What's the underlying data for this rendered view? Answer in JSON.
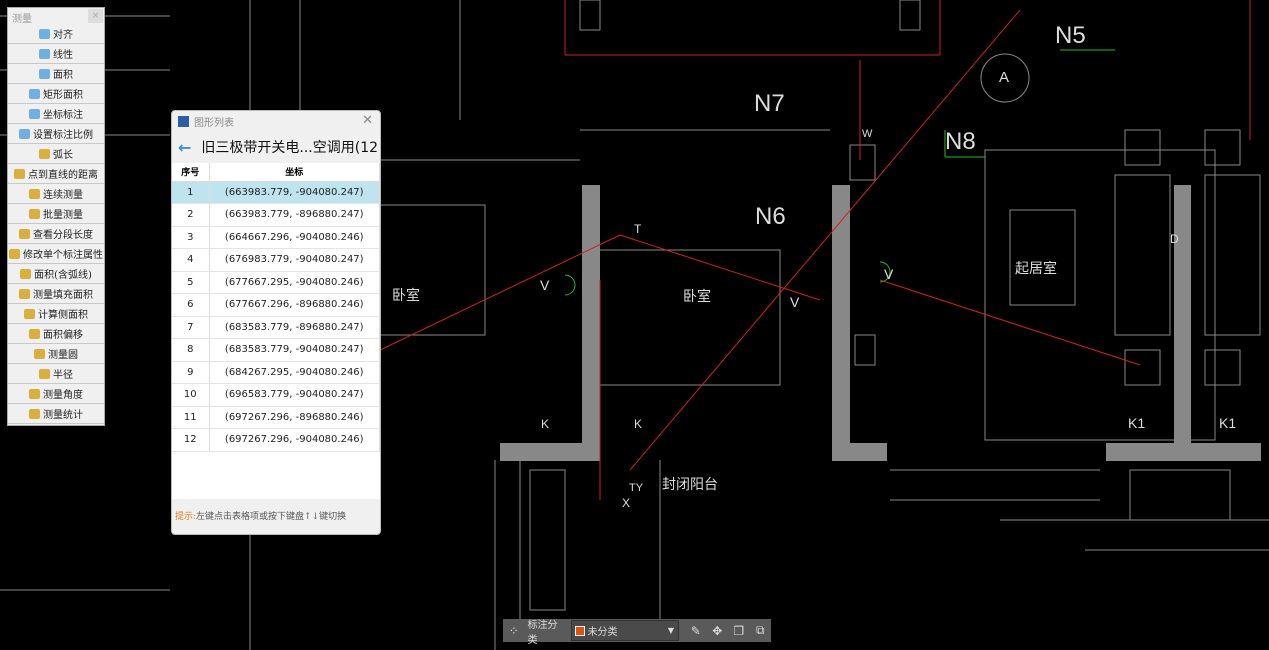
{
  "cad_labels": {
    "n5": "N5",
    "n7": "N7",
    "n8": "N8",
    "n6": "N6",
    "a": "A",
    "w": "W",
    "bedroom1": "卧室",
    "bedroom2": "卧室",
    "living": "起居室",
    "balcony": "封闭阳台",
    "v1": "V",
    "v2": "V",
    "v3": "V",
    "t": "T",
    "k1": "K",
    "k2": "K",
    "ty": "TY",
    "x": "X",
    "k1a": "K1",
    "k1b": "K1",
    "d": "D"
  },
  "measure_panel": {
    "title": "测量",
    "close": "×",
    "items": [
      {
        "label": "对齐",
        "icon": "align-icon"
      },
      {
        "label": "线性",
        "icon": "linear-icon"
      },
      {
        "label": "面积",
        "icon": "area-icon"
      },
      {
        "label": "矩形面积",
        "icon": "rect-area-icon"
      },
      {
        "label": "坐标标注",
        "icon": "coordinate-icon"
      },
      {
        "label": "设置标注比例",
        "icon": "scale-icon"
      },
      {
        "label": "弧长",
        "icon": "arc-icon"
      },
      {
        "label": "点到直线的距离",
        "icon": "point-line-icon"
      },
      {
        "label": "连续测量",
        "icon": "continuous-icon"
      },
      {
        "label": "批量测量",
        "icon": "batch-icon"
      },
      {
        "label": "查看分段长度",
        "icon": "segment-icon"
      },
      {
        "label": "修改单个标注属性",
        "icon": "edit-icon"
      },
      {
        "label": "面积(含弧线)",
        "icon": "arc-area-icon"
      },
      {
        "label": "测量填充面积",
        "icon": "fill-area-icon"
      },
      {
        "label": "计算侧面积",
        "icon": "side-area-icon"
      },
      {
        "label": "面积偏移",
        "icon": "offset-icon"
      },
      {
        "label": "测量圆",
        "icon": "circle-icon"
      },
      {
        "label": "半径",
        "icon": "radius-icon"
      },
      {
        "label": "测量角度",
        "icon": "angle-icon"
      },
      {
        "label": "测量统计",
        "icon": "stats-icon"
      }
    ]
  },
  "dialog": {
    "window_title": "图形列表",
    "close": "✕",
    "heading": "旧三极带开关电...空调用(12",
    "columns": [
      "序号",
      "坐标"
    ],
    "rows": [
      [
        "1",
        "(663983.779, -904080.247)"
      ],
      [
        "2",
        "(663983.779, -896880.247)"
      ],
      [
        "3",
        "(664667.296, -904080.246)"
      ],
      [
        "4",
        "(676983.779, -904080.247)"
      ],
      [
        "5",
        "(677667.295, -904080.246)"
      ],
      [
        "6",
        "(677667.296, -896880.246)"
      ],
      [
        "7",
        "(683583.779, -896880.247)"
      ],
      [
        "8",
        "(683583.779, -904080.247)"
      ],
      [
        "9",
        "(684267.295, -904080.246)"
      ],
      [
        "10",
        "(696583.779, -904080.247)"
      ],
      [
        "11",
        "(697267.296, -896880.246)"
      ],
      [
        "12",
        "(697267.296, -904080.246)"
      ]
    ],
    "selected_row": 1,
    "tip_label": "提示:",
    "tip_text": "左键点击表格项或按下键盘↑↓键切换"
  },
  "bottom_bar": {
    "label": "标注分类",
    "category": "未分类",
    "category_color": "#e05010"
  }
}
